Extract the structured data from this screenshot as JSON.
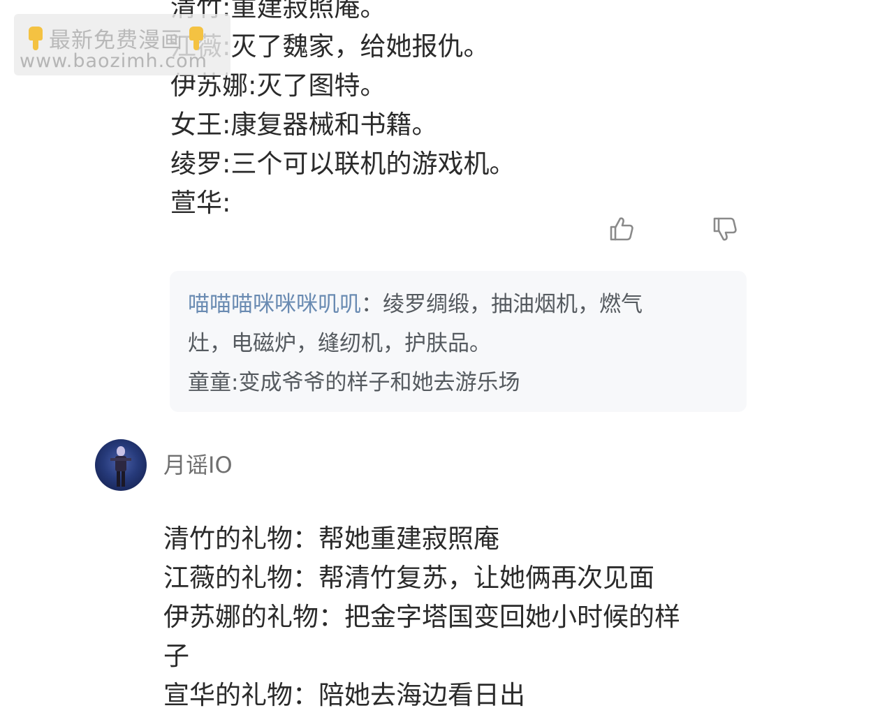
{
  "watermark": {
    "line1": "最新免费漫画",
    "line2": "www.baozimh.com"
  },
  "comment1": {
    "lines": [
      "清竹:重建寂照庵。",
      "江薇:灭了魏家，给她报仇。",
      "伊苏娜:灭了图特。",
      "女王:康复器械和书籍。",
      "绫罗:三个可以联机的游戏机。",
      "萱华:"
    ]
  },
  "reply": {
    "username": "喵喵喵咪咪咪叽叽",
    "separator": "：",
    "text_part1": "绫罗绸缎，抽油烟机，燃气",
    "text_part2": "灶，电磁炉，缝纫机，护肤品。",
    "line2": "童童:变成爷爷的样子和她去游乐场"
  },
  "comment2": {
    "username": "月谣IO",
    "lines": [
      "清竹的礼物：帮她重建寂照庵",
      "江薇的礼物：帮清竹复苏，让她俩再次见面",
      "伊苏娜的礼物：把金字塔国变回她小时候的样",
      "子",
      "宣华的礼物：陪她去海边看日出"
    ]
  },
  "icons": {
    "like": "thumbs-up-icon",
    "dislike": "thumbs-down-icon",
    "watermark_hand": "pointing-down-hand-icon"
  },
  "colors": {
    "body_text": "#2a2a2a",
    "reply_username": "#6a8bb2",
    "reply_text": "#555a5f",
    "reply_background": "#f7f8fa",
    "username_gray": "#6f6f6f",
    "icon_gray": "#8a8a8a"
  }
}
